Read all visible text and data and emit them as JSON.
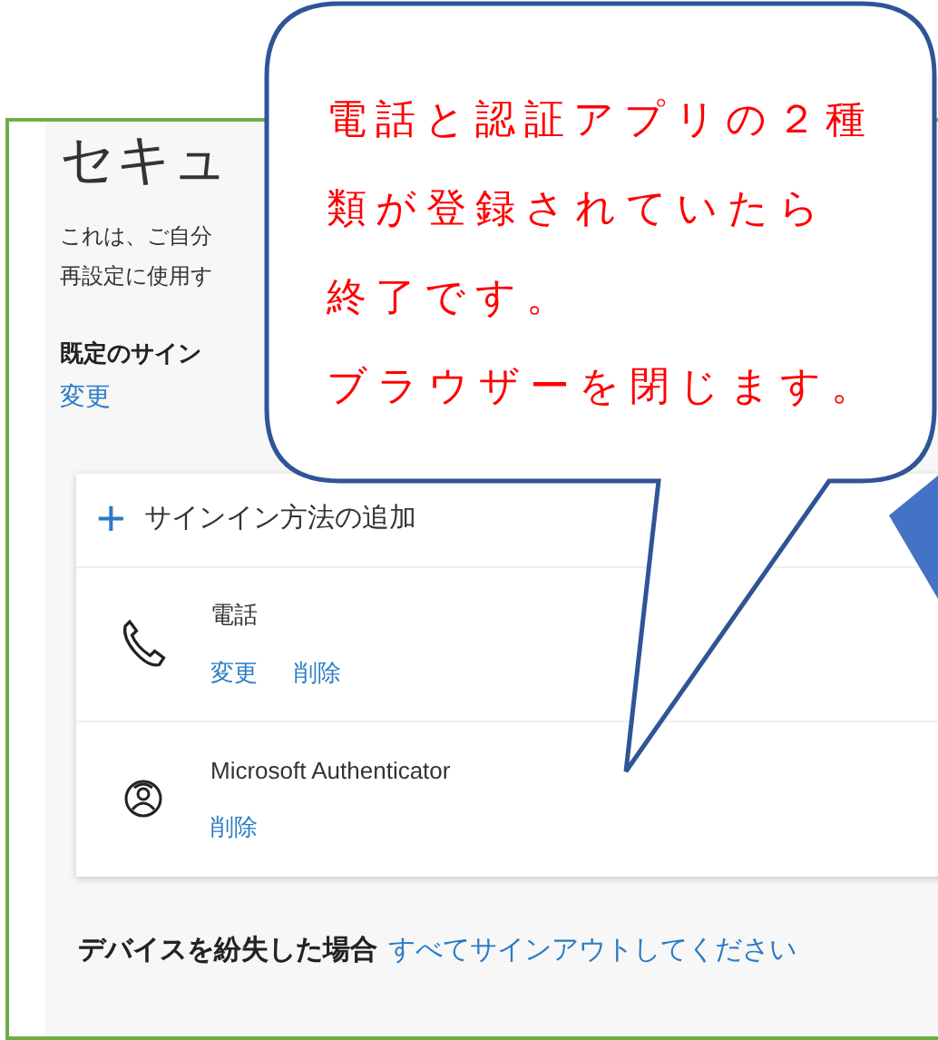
{
  "page": {
    "title": "セキュ",
    "description": [
      "これは、ご自分",
      "再設定に使用す"
    ],
    "default_signin": {
      "label": "既定のサイン",
      "link": "変更"
    }
  },
  "methods": {
    "add": {
      "icon": "+",
      "label": "サインイン方法の追加"
    },
    "items": [
      {
        "kind": "phone",
        "name": "電話",
        "actions": [
          "変更",
          "削除"
        ]
      },
      {
        "kind": "authenticator",
        "name": "Microsoft Authenticator",
        "actions": [
          "削除"
        ]
      }
    ]
  },
  "lost_device": {
    "text": "デバイスを紛失した場合",
    "link": "すべてサインアウトしてください"
  },
  "callout": {
    "lines": [
      "電話と認証アプリの２種",
      "類が登録されていたら",
      "終了です。",
      "ブラウザーを閉じます。"
    ]
  }
}
